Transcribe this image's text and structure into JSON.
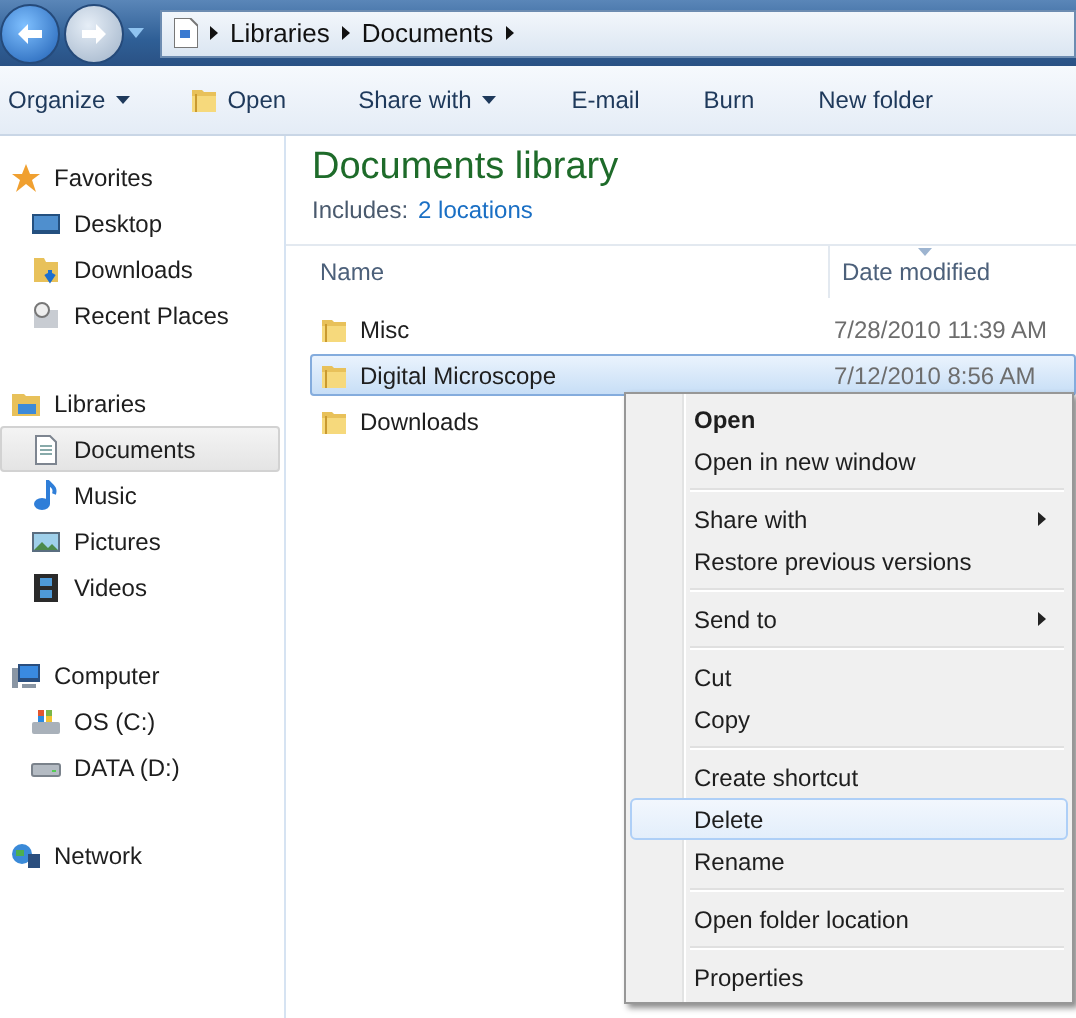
{
  "address_bar": {
    "breadcrumbs": [
      "Libraries",
      "Documents"
    ]
  },
  "toolbar": [
    {
      "label": "Organize",
      "kind": "menu"
    },
    {
      "label": "Open",
      "kind": "open"
    },
    {
      "label": "Share with",
      "kind": "menu"
    },
    {
      "label": "E-mail",
      "kind": "command"
    },
    {
      "label": "Burn",
      "kind": "command"
    },
    {
      "label": "New folder",
      "kind": "command"
    }
  ],
  "sidebar": {
    "sections": [
      {
        "label": "Favorites",
        "kind": "star",
        "selected": false,
        "items": [
          {
            "label": "Desktop",
            "kind": "desktop",
            "selected": false
          },
          {
            "label": "Downloads",
            "kind": "downloads",
            "selected": false
          },
          {
            "label": "Recent Places",
            "kind": "recent",
            "selected": false
          }
        ]
      },
      {
        "label": "Libraries",
        "kind": "library",
        "selected": false,
        "items": [
          {
            "label": "Documents",
            "kind": "document",
            "selected": true
          },
          {
            "label": "Music",
            "kind": "music",
            "selected": false
          },
          {
            "label": "Pictures",
            "kind": "pictures",
            "selected": false
          },
          {
            "label": "Videos",
            "kind": "videos",
            "selected": false
          }
        ]
      },
      {
        "label": "Computer",
        "kind": "computer",
        "selected": false,
        "items": [
          {
            "label": "OS (C:)",
            "kind": "osdrive",
            "selected": false
          },
          {
            "label": "DATA (D:)",
            "kind": "drive",
            "selected": false
          }
        ]
      },
      {
        "label": "Network",
        "kind": "network",
        "selected": false
      }
    ]
  },
  "library": {
    "title": "Documents library",
    "includes_label": "Includes:",
    "includes_link": "2 locations"
  },
  "table": {
    "columns": [
      "Name",
      "Date modified"
    ],
    "rows": [
      {
        "name": "Misc",
        "date": "7/28/2010 11:39 AM",
        "selected": false
      },
      {
        "name": "Digital Microscope",
        "date": "7/12/2010 8:56 AM",
        "selected": true
      },
      {
        "name": "Downloads",
        "selected": false
      }
    ]
  },
  "context_menu": {
    "groups": [
      [
        {
          "label": "Open",
          "default": true,
          "submenu": false,
          "selected": false
        },
        {
          "label": "Open in new window",
          "default": false,
          "submenu": false,
          "selected": false
        }
      ],
      [
        {
          "label": "Share with",
          "default": false,
          "submenu": true,
          "selected": false
        },
        {
          "label": "Restore previous versions",
          "default": false,
          "submenu": false,
          "selected": false
        }
      ],
      [
        {
          "label": "Send to",
          "default": false,
          "submenu": true,
          "selected": false
        }
      ],
      [
        {
          "label": "Cut",
          "default": false,
          "submenu": false,
          "selected": false
        },
        {
          "label": "Copy",
          "default": false,
          "submenu": false,
          "selected": false
        }
      ],
      [
        {
          "label": "Create shortcut",
          "default": false,
          "submenu": false,
          "selected": false
        },
        {
          "label": "Delete",
          "default": false,
          "submenu": false,
          "selected": true
        },
        {
          "label": "Rename",
          "default": false,
          "submenu": false,
          "selected": false
        }
      ],
      [
        {
          "label": "Open folder location",
          "default": false,
          "submenu": false,
          "selected": false
        }
      ],
      [
        {
          "label": "Properties",
          "default": false,
          "submenu": false,
          "selected": false
        }
      ]
    ]
  }
}
